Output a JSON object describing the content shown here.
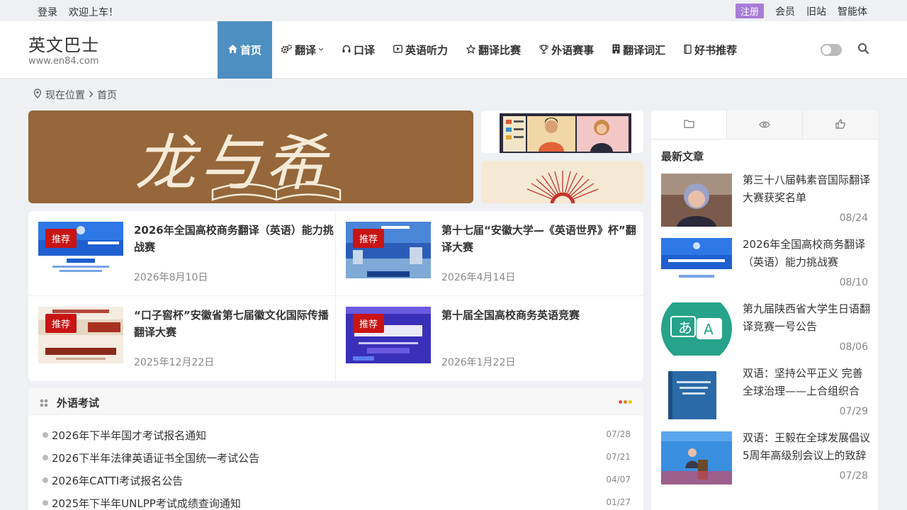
{
  "topbar": {
    "login": "登录",
    "welcome": "欢迎上车！",
    "register": "注册",
    "member": "会员",
    "old_site": "旧站",
    "agent": "智能体"
  },
  "site": {
    "title": "英文巴士",
    "url": "www.en84.com"
  },
  "nav": [
    {
      "label": "首页",
      "icon": "home-icon"
    },
    {
      "label": "翻译",
      "icon": "gears-icon"
    },
    {
      "label": "口译",
      "icon": "headset-icon"
    },
    {
      "label": "英语听力",
      "icon": "play-icon"
    },
    {
      "label": "翻译比赛",
      "icon": "star-icon"
    },
    {
      "label": "外语赛事",
      "icon": "trophy-icon"
    },
    {
      "label": "翻译词汇",
      "icon": "building-icon"
    },
    {
      "label": "好书推荐",
      "icon": "book-icon"
    }
  ],
  "breadcrumb": {
    "location_label": "现在位置",
    "current": "首页"
  },
  "banner": {
    "main_text": "龙与希"
  },
  "featured": [
    {
      "tag": "推荐",
      "title": "2026年全国高校商务翻译（英语）能力挑战赛",
      "date": "2026年8月10日"
    },
    {
      "tag": "推荐",
      "title": "第十七届“安徽大学—《英语世界》杯”翻译大赛",
      "date": "2026年4月14日"
    },
    {
      "tag": "推荐",
      "title": "“口子窖杯”安徽省第七届徽文化国际传播翻译大赛",
      "date": "2025年12月22日"
    },
    {
      "tag": "推荐",
      "title": "第十届全国高校商务英语竞赛",
      "date": "2026年1月22日"
    }
  ],
  "exam": {
    "title": "外语考试",
    "items": [
      {
        "title": "2026年下半年国才考试报名通知",
        "date": "07/28"
      },
      {
        "title": "2026下半年法律英语证书全国统一考试公告",
        "date": "07/21"
      },
      {
        "title": "2026年CATTI考试报名公告",
        "date": "04/07"
      },
      {
        "title": "2025年下半年UNLPP考试成绩查询通知",
        "date": "01/27"
      }
    ]
  },
  "sidebar": {
    "heading": "最新文章",
    "items": [
      {
        "title": "第三十八届韩素音国际翻译大赛获奖名单",
        "date": "08/24"
      },
      {
        "title": "2026年全国高校商务翻译（英语）能力挑战赛",
        "date": "08/10"
      },
      {
        "title": "第九届陕西省大学生日语翻译竞赛一号公告",
        "date": "08/06"
      },
      {
        "title": "双语：坚持公平正义 完善全球治理——上合组织合作…",
        "date": "07/29"
      },
      {
        "title": "双语：王毅在全球发展倡议5周年高级别会议上的致辞",
        "date": "07/28"
      }
    ]
  },
  "colors": {
    "nav_active": "#4e8fc1",
    "tag_red": "#c81414",
    "register_purple": "#a77dd6",
    "banner_brown": "#95673a"
  }
}
